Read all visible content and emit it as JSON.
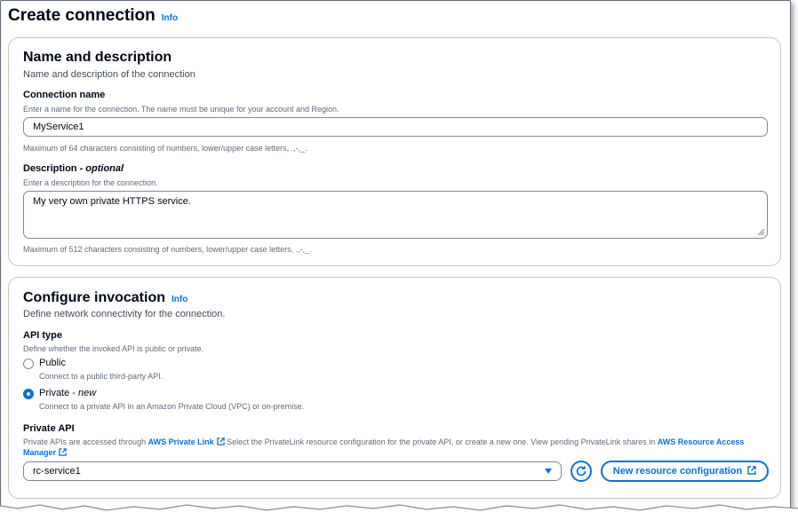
{
  "page": {
    "title": "Create connection",
    "info_label": "Info"
  },
  "name_section": {
    "title": "Name and description",
    "description": "Name and description of the connection",
    "connection_name": {
      "label": "Connection name",
      "hint": "Enter a name for the connection. The name must be unique for your account and Region.",
      "value": "MyService1",
      "constraint": "Maximum of 64 characters consisting of numbers, lower/upper case letters, .,-,_."
    },
    "description_field": {
      "label": "Description - ",
      "label_optional": "optional",
      "hint": "Enter a description for the connection.",
      "value": "My very own private HTTPS service.",
      "constraint": "Maximum of 512 characters consisting of numbers, lower/upper case letters, .,-,_."
    }
  },
  "invocation_section": {
    "title": "Configure invocation",
    "info_label": "Info",
    "description": "Define network connectivity for the connection.",
    "api_type": {
      "label": "API type",
      "hint": "Define whether the invoked API is public or private.",
      "options": [
        {
          "label": "Public",
          "suffix": "",
          "description": "Connect to a public third-party API.",
          "selected": false
        },
        {
          "label": "Private - ",
          "suffix": "new",
          "description": "Connect to a private API in an Amazon Private Cloud (VPC) or on-premise.",
          "selected": true
        }
      ]
    },
    "private_api": {
      "label": "Private API",
      "hint_part1": "Private APIs are accessed through ",
      "link1": "AWS Private Link",
      "hint_part2": " Select the PrivateLink resource configuration for the private API, or create a new one. View pending PrivateLink shares in ",
      "link2": "AWS Resource Access Manager",
      "selected_value": "rc-service1",
      "new_button_label": "New resource configuration"
    }
  },
  "icons": [
    "external-link-icon",
    "refresh-icon",
    "caret-down-icon",
    "resize-handle-icon"
  ],
  "colors": {
    "accent": "#0972d3",
    "border": "#7d8998",
    "text": "#000716",
    "muted": "#5f6b7a"
  }
}
